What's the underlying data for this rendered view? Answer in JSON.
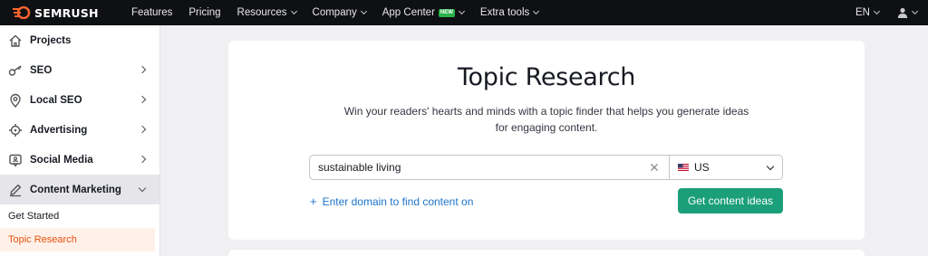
{
  "brand": {
    "name": "SEMRUSH",
    "accent": "#ff642d"
  },
  "topnav": {
    "items": [
      {
        "label": "Features",
        "dropdown": false
      },
      {
        "label": "Pricing",
        "dropdown": false
      },
      {
        "label": "Resources",
        "dropdown": true
      },
      {
        "label": "Company",
        "dropdown": true
      },
      {
        "label": "App Center",
        "dropdown": true,
        "badge": "NEW"
      },
      {
        "label": "Extra tools",
        "dropdown": true
      }
    ],
    "language": "EN",
    "user_icon": "user-icon"
  },
  "sidebar": {
    "items": [
      {
        "label": "Projects",
        "icon": "home-icon"
      },
      {
        "label": "SEO",
        "icon": "key-icon"
      },
      {
        "label": "Local SEO",
        "icon": "location-pin-icon"
      },
      {
        "label": "Advertising",
        "icon": "target-icon"
      },
      {
        "label": "Social Media",
        "icon": "social-chat-icon"
      },
      {
        "label": "Content Marketing",
        "icon": "pencil-icon",
        "expanded": true
      }
    ],
    "subitems": [
      {
        "label": "Get Started"
      },
      {
        "label": "Topic Research",
        "selected": true
      }
    ]
  },
  "main": {
    "title": "Topic Research",
    "description_line1": "Win your readers' hearts and minds with a topic finder that helps you generate ideas",
    "description_line2": "for engaging content.",
    "search": {
      "value": "sustainable living",
      "placeholder": ""
    },
    "country": {
      "label": "US",
      "flag": "us-flag-icon"
    },
    "add_domain_label": "Enter domain to find content on",
    "cta_label": "Get content ideas",
    "colors": {
      "cta": "#1b9f7a",
      "link": "#1d73c9",
      "selected": "#e8500a"
    }
  }
}
